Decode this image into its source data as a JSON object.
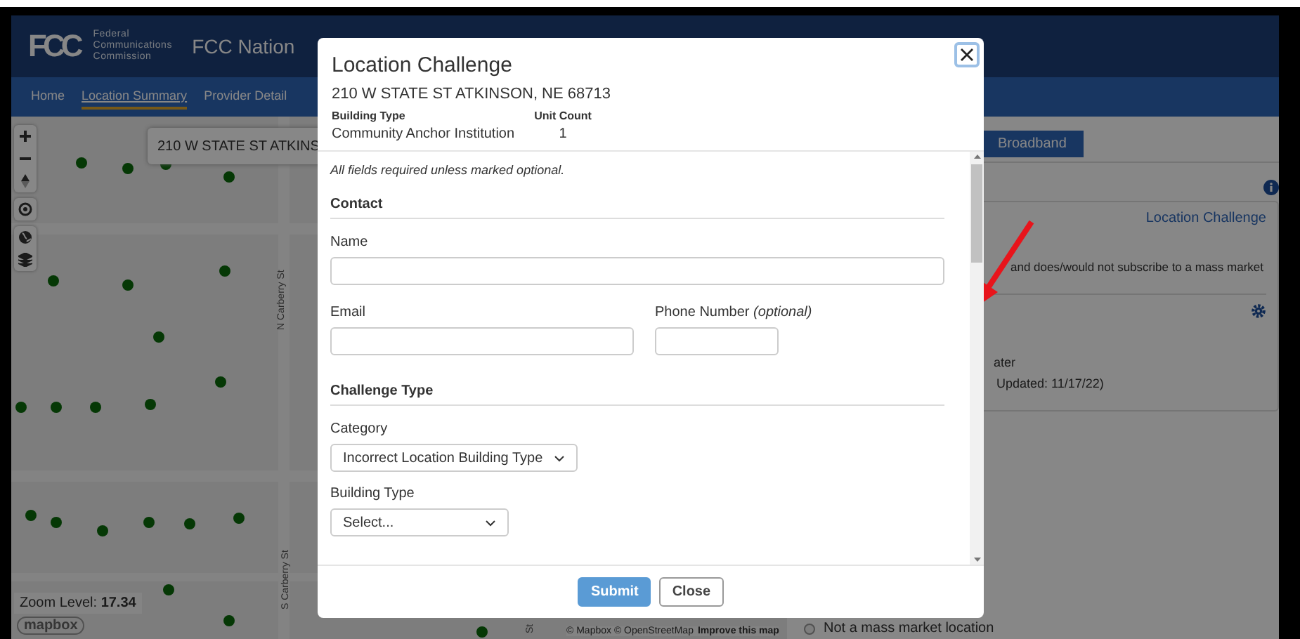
{
  "header": {
    "agency_lines": [
      "Federal",
      "Communications",
      "Commission"
    ],
    "logo": "FCC",
    "title": "FCC Nation"
  },
  "nav": [
    {
      "label": "Home",
      "selected": false
    },
    {
      "label": "Location Summary",
      "selected": true
    },
    {
      "label": "Provider Detail",
      "selected": false
    }
  ],
  "map": {
    "search_value": "210 W STATE ST ATKINS",
    "street_north": "N Carberry St",
    "street_south": "S Carberry St",
    "street_east": "St",
    "zoom": "Zoom Level: **17.34**",
    "logo": "mapbox",
    "credits": "© Mapbox © OpenStreetMap",
    "improve_link": "Improve this map"
  },
  "right_panel": {
    "tab": "Broadband",
    "link": "Location Challenge",
    "text_1": "and does/would not subscribe to a mass market",
    "text_2": "ater",
    "text_3": "Updated: 11/17/22)",
    "radio": {
      "label": "Not a mass market location",
      "selected": false
    }
  },
  "modal": {
    "title": "Location Challenge",
    "address": "210 W STATE ST ATKINSON, NE 68713",
    "details": [
      {
        "label": "Building Type",
        "value": "Community Anchor Institution"
      },
      {
        "label": "Unit Count",
        "value": "1"
      }
    ],
    "note": "All fields required unless marked optional.",
    "contact": {
      "heading": "Contact",
      "name_label": "Name",
      "email_label": "Email",
      "phone_label": "Phone Number *(optional)*"
    },
    "challenge": {
      "heading": "Challenge Type",
      "category_label": "Category",
      "category_value": "Incorrect Location Building Type",
      "building_label": "Building Type",
      "building_value": "Select..."
    },
    "buttons": [
      {
        "label": "Submit",
        "kind": "primary"
      },
      {
        "label": "Close",
        "kind": "secondary"
      }
    ]
  }
}
